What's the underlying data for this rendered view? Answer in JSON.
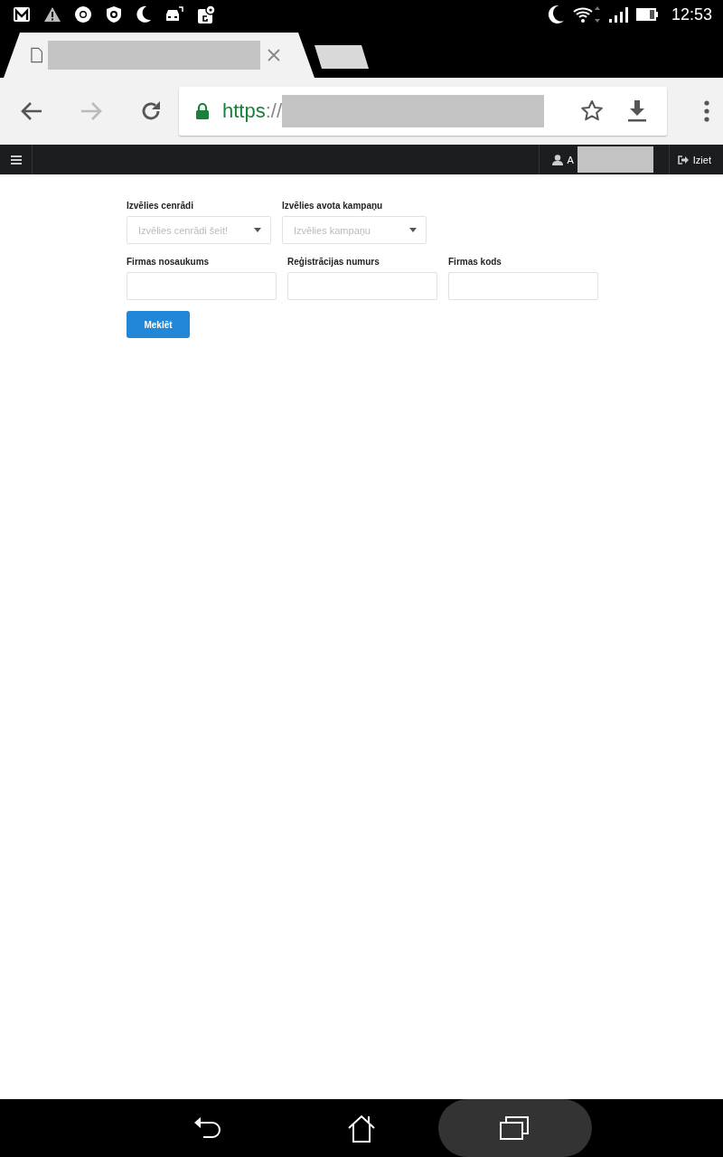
{
  "status_bar": {
    "time": "12:53"
  },
  "browser": {
    "url": {
      "scheme": "https",
      "separator": "://"
    }
  },
  "navbar": {
    "user_initial": "A",
    "logout": "Iziet"
  },
  "form": {
    "selects": [
      {
        "label": "Izvēlies cenrādi",
        "placeholder": "Izvēlies cenrādi šeit!"
      },
      {
        "label": "Izvēlies avota kampaņu",
        "placeholder": "Izvēlies kampaņu"
      }
    ],
    "fields": [
      {
        "label": "Firmas nosaukums"
      },
      {
        "label": "Reģistrācijas numurs"
      },
      {
        "label": "Firmas kods"
      }
    ],
    "button": "Meklēt"
  }
}
